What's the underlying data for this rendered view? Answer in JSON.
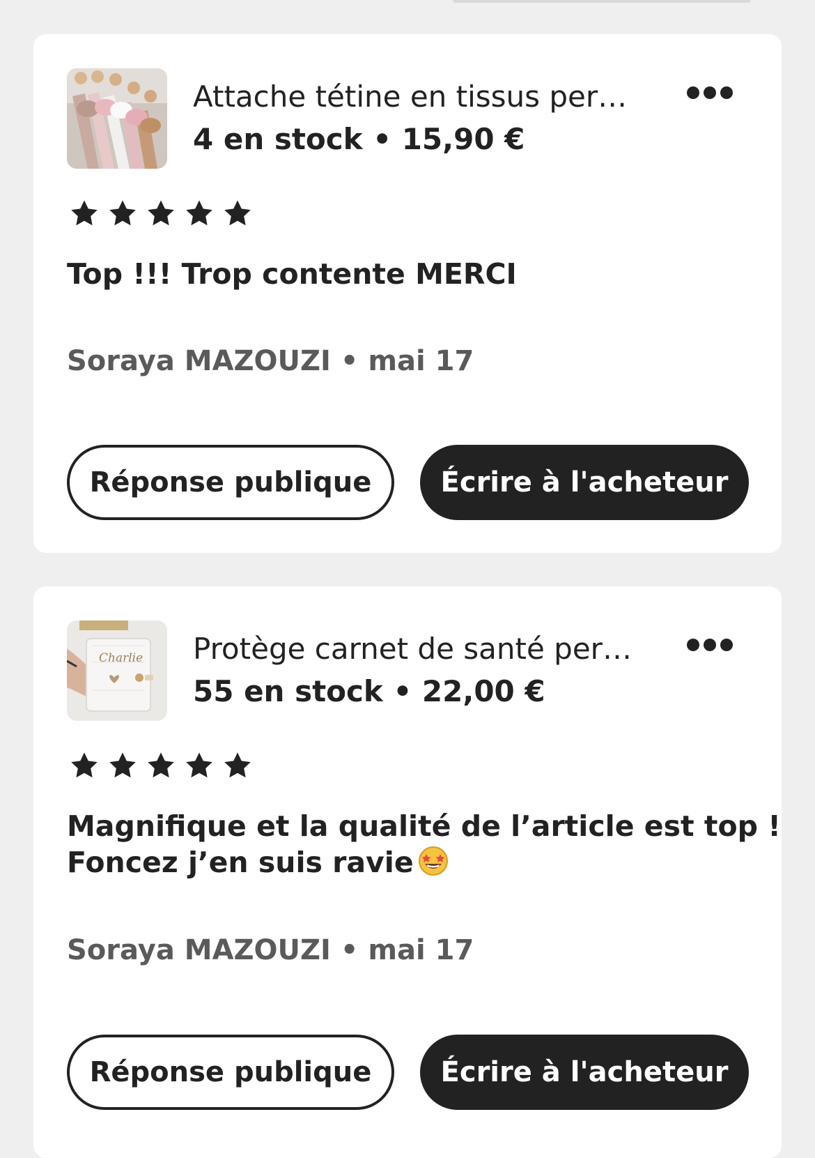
{
  "reviews": [
    {
      "product": {
        "title": "Attache tétine en tissus per…",
        "meta": "4 en stock • 15,90 €",
        "thumbnail_icon": "pacifier-clips-photo"
      },
      "rating": 5,
      "text_lines": [
        "Top !!! Trop contente MERCI"
      ],
      "reviewer": "Soraya MAZOUZI • mai 17",
      "public_reply_label": "Réponse publique",
      "message_buyer_label": "Écrire à l'acheteur"
    },
    {
      "product": {
        "title": "Protège carnet de santé per…",
        "meta": "55 en stock • 22,00 €",
        "thumbnail_icon": "health-book-cover-photo",
        "thumbnail_text": "Charlie"
      },
      "rating": 5,
      "text_lines": [
        "Magnifique et la qualité de l’article est top !",
        "Foncez j’en suis ravie"
      ],
      "text_emoji_icon": "star-struck-emoji",
      "reviewer": "Soraya MAZOUZI • mai 17",
      "public_reply_label": "Réponse publique",
      "message_buyer_label": "Écrire à l'acheteur"
    }
  ],
  "colors": {
    "background": "#efefef",
    "card": "#ffffff",
    "primary_dark": "#222222",
    "muted_text": "#5a5a5a"
  }
}
